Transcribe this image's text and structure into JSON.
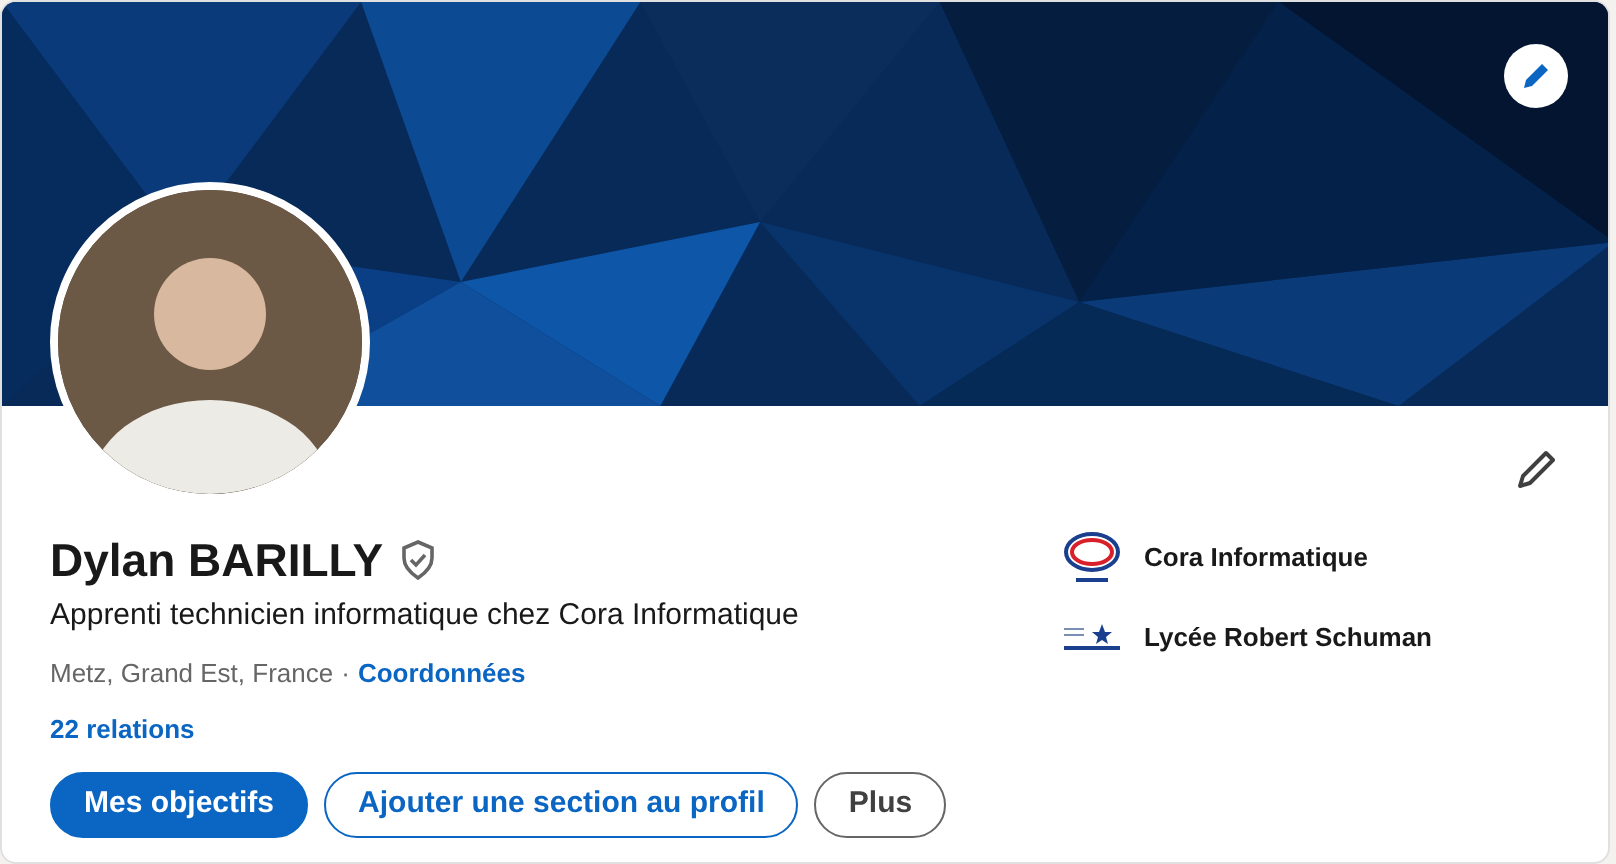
{
  "profile": {
    "name": "Dylan BARILLY",
    "verified": true,
    "headline": "Apprenti technicien informatique chez Cora Informatique",
    "location": "Metz, Grand Est, France",
    "separator": "·",
    "contact_link": "Coordonnées",
    "connections": "22 relations"
  },
  "organizations": [
    {
      "kind": "company",
      "name": "Cora Informatique"
    },
    {
      "kind": "school",
      "name": "Lycée Robert Schuman"
    }
  ],
  "buttons": [
    {
      "kind": "primary",
      "label": "Mes objectifs"
    },
    {
      "kind": "outline",
      "label": "Ajouter une section au profil"
    },
    {
      "kind": "secondary",
      "label": "Plus"
    }
  ]
}
